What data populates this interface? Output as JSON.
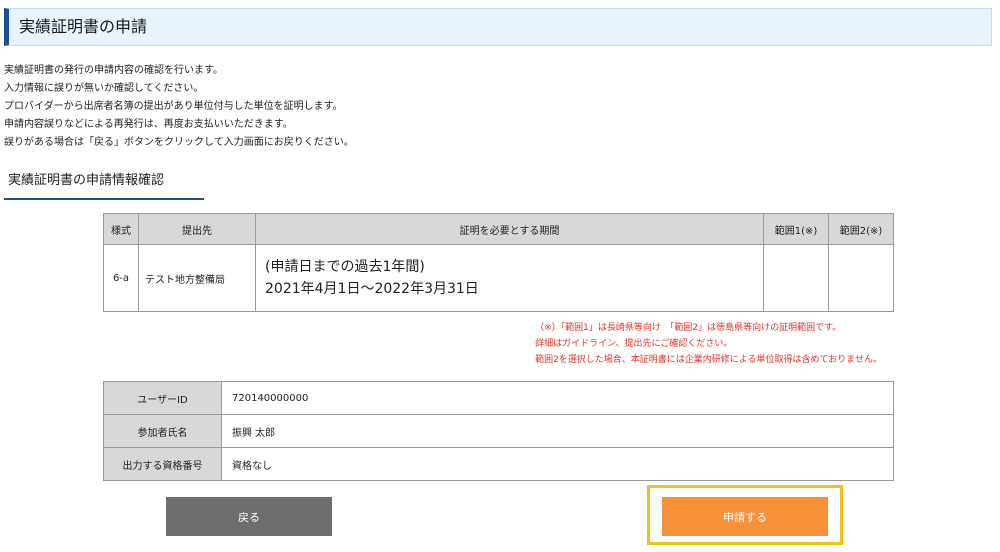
{
  "header": {
    "title": "実績証明書の申請"
  },
  "intro": {
    "lines": [
      "実績証明書の発行の申請内容の確認を行います。",
      "入力情報に誤りが無いか確認してください。",
      "プロバイダーから出席者名簿の提出があり単位付与した単位を証明します。",
      "申請内容誤りなどによる再発行は、再度お支払いいただきます。",
      "誤りがある場合は「戻る」ボタンをクリックして入力画面にお戻りください。"
    ]
  },
  "section": {
    "title": "実績証明書の申請情報確認"
  },
  "request_table": {
    "headers": [
      "様式",
      "提出先",
      "証明を必要とする期間",
      "範囲1(※)",
      "範囲2(※)"
    ],
    "row": {
      "form": "6-a",
      "destination": "テスト地方整備局",
      "period_line1": "(申請日までの過去1年間)",
      "period_line2": "2021年4月1日～2022年3月31日",
      "range1": "",
      "range2": ""
    }
  },
  "notes": [
    "（※）「範囲1」は長崎県等向け　「範囲2」は徳島県等向けの証明範囲です。",
    "詳細はガイドライン、提出先にご確認ください。",
    "範囲2を選択した場合、本証明書には企業内研修による単位取得は含めておりません。"
  ],
  "user_table": {
    "rows": [
      {
        "label": "ユーザーID",
        "value": "720140000000"
      },
      {
        "label": "参加者氏名",
        "value": "振興 太郎"
      },
      {
        "label": "出力する資格番号",
        "value": "資格なし"
      }
    ]
  },
  "buttons": {
    "back_label": "戻る",
    "submit_label": "申請する"
  },
  "colors": {
    "header_accent": "#1d4f91",
    "header_bg": "#e8f3fb",
    "note_text": "#e4342a",
    "back_button": "#6e6e6e",
    "submit_button": "#f7923a",
    "highlight": "#f2c01a"
  }
}
